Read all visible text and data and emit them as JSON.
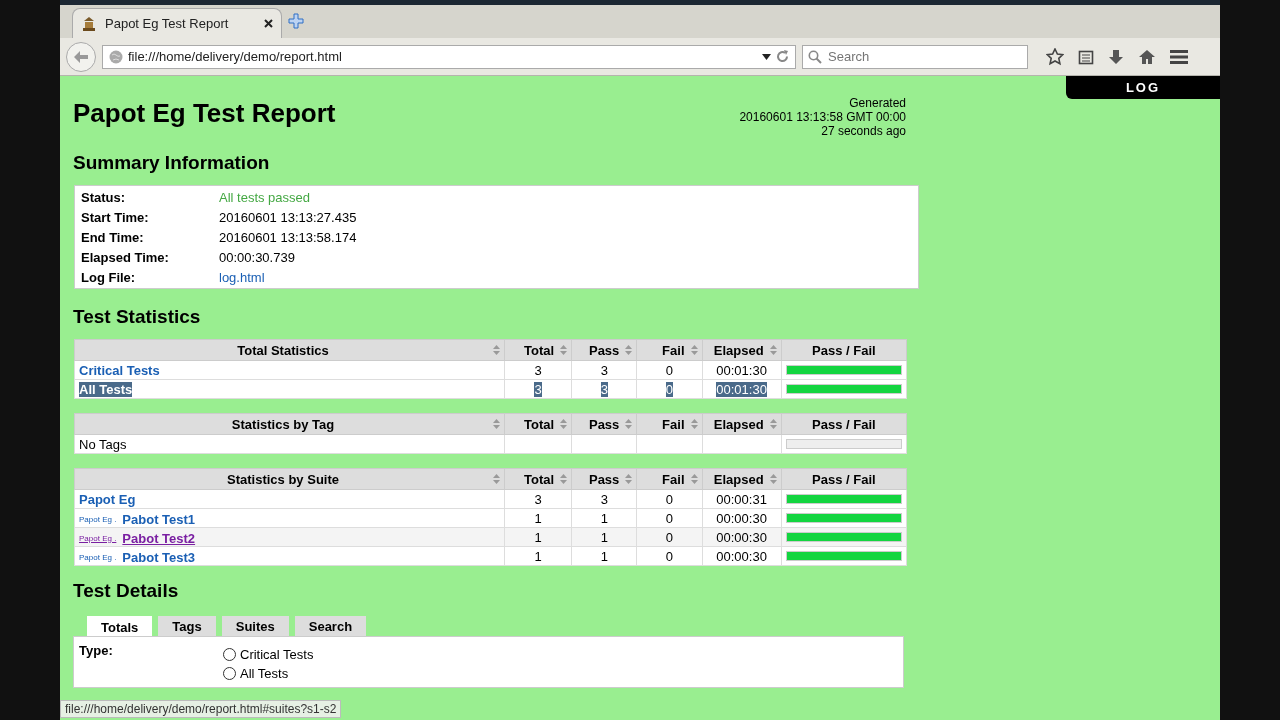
{
  "browser": {
    "tab": {
      "title": "Papot Eg Test Report",
      "selected": true
    },
    "url": "file:///home/delivery/demo/report.html",
    "search": {
      "placeholder": "Search"
    },
    "status_url": "file:///home/delivery/demo/report.html#suites?s1-s2"
  },
  "log_button": "LOG",
  "header": {
    "title": "Papot Eg Test Report",
    "generated": [
      "Generated",
      "20160601 13:13:58 GMT 00:00",
      "27 seconds ago"
    ]
  },
  "summary": {
    "heading": "Summary Information",
    "rows": [
      {
        "label": "Status:",
        "value": "All tests passed",
        "kind": "status"
      },
      {
        "label": "Start Time:",
        "value": "20160601 13:13:27.435",
        "kind": "text"
      },
      {
        "label": "End Time:",
        "value": "20160601 13:13:58.174",
        "kind": "text"
      },
      {
        "label": "Elapsed Time:",
        "value": "00:00:30.739",
        "kind": "text"
      },
      {
        "label": "Log File:",
        "value": "log.html",
        "kind": "link"
      }
    ]
  },
  "statistics": {
    "heading": "Test Statistics",
    "tables": [
      {
        "columns": [
          "Total Statistics",
          "Total",
          "Pass",
          "Fail",
          "Elapsed",
          "Pass / Fail"
        ],
        "rows": [
          {
            "name": "Critical Tests",
            "total": "3",
            "pass": "3",
            "fail": "0",
            "elapsed": "00:01:30",
            "level": 1,
            "kind": "link"
          },
          {
            "name": "All Tests",
            "total": "3",
            "pass": "3",
            "fail": "0",
            "elapsed": "00:01:30",
            "level": 1,
            "kind": "link",
            "highlighted": true
          }
        ]
      },
      {
        "columns": [
          "Statistics by Tag",
          "Total",
          "Pass",
          "Fail",
          "Elapsed",
          "Pass / Fail"
        ],
        "rows": [
          {
            "name": "No Tags",
            "kind": "plain"
          }
        ]
      },
      {
        "columns": [
          "Statistics by Suite",
          "Total",
          "Pass",
          "Fail",
          "Elapsed",
          "Pass / Fail"
        ],
        "rows": [
          {
            "name": "Papot Eg",
            "total": "3",
            "pass": "3",
            "fail": "0",
            "elapsed": "00:00:31",
            "level": 1,
            "kind": "link"
          },
          {
            "parent": "Papot Eg .",
            "name": "Pabot Test1",
            "total": "1",
            "pass": "1",
            "fail": "0",
            "elapsed": "00:00:30",
            "level": 1,
            "kind": "link"
          },
          {
            "parent": "Papot Eg .",
            "name": "Pabot Test2",
            "total": "1",
            "pass": "1",
            "fail": "0",
            "elapsed": "00:00:30",
            "level": 1,
            "kind": "link",
            "hovered": true
          },
          {
            "parent": "Papot Eg .",
            "name": "Pabot Test3",
            "total": "1",
            "pass": "1",
            "fail": "0",
            "elapsed": "00:00:30",
            "level": 1,
            "kind": "link"
          }
        ]
      }
    ]
  },
  "details": {
    "heading": "Test Details",
    "tabs": [
      {
        "label": "Totals",
        "selected": true
      },
      {
        "label": "Tags",
        "selected": false
      },
      {
        "label": "Suites",
        "selected": false
      },
      {
        "label": "Search",
        "selected": false
      }
    ],
    "type_label": "Type:",
    "options": [
      {
        "label": "Critical Tests",
        "checked": false
      },
      {
        "label": "All Tests",
        "checked": false
      }
    ]
  }
}
